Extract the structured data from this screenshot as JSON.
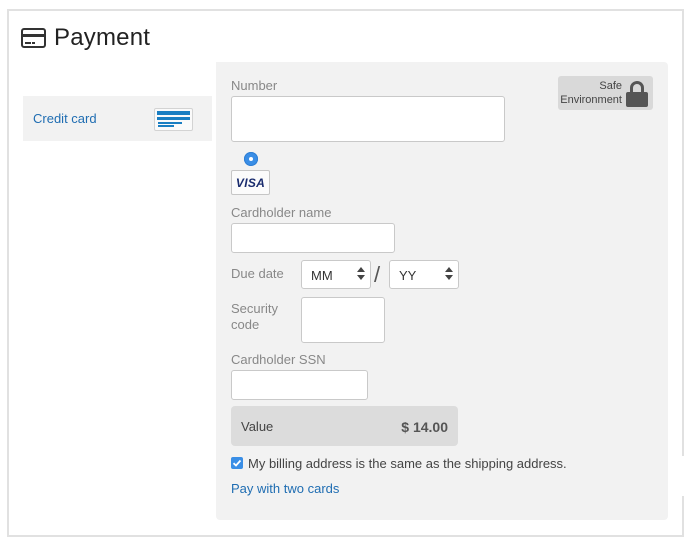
{
  "header": {
    "title": "Payment",
    "icon": "credit-card-icon"
  },
  "sidebar": {
    "items": [
      {
        "label": "Credit card",
        "icon": "credit-card-icon",
        "selected": true
      }
    ]
  },
  "safe_badge": {
    "line1": "Safe",
    "line2": "Environment",
    "icon": "lock-icon"
  },
  "form": {
    "number_label": "Number",
    "number_value": "",
    "card_brand": "VISA",
    "holder_label": "Cardholder name",
    "holder_value": "",
    "due_label": "Due date",
    "month_value": "MM",
    "year_value": "YY",
    "date_separator": "/",
    "security_label_1": "Security",
    "security_label_2": "code",
    "security_value": "",
    "ssn_label": "Cardholder SSN",
    "ssn_value": ""
  },
  "summary": {
    "value_label": "Value",
    "value_amount": "$ 14.00"
  },
  "billing": {
    "checked": true,
    "label": "My billing address is the same as the shipping address."
  },
  "links": {
    "two_cards": "Pay with two cards"
  },
  "colors": {
    "accent": "#3a8ee6",
    "link": "#1f6db2",
    "panel": "#f2f2f2"
  }
}
